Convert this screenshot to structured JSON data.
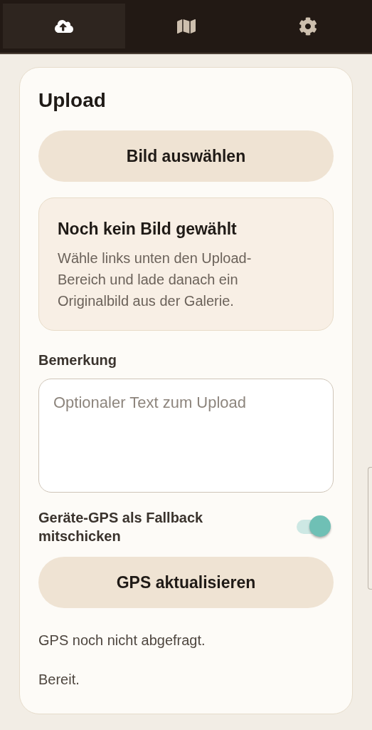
{
  "tabs": [
    {
      "kind": "upload",
      "selected": true
    },
    {
      "kind": "map",
      "selected": false
    },
    {
      "kind": "settings",
      "selected": false
    }
  ],
  "card": {
    "title": "Upload",
    "pick_button": "Bild auswählen",
    "preview": {
      "title": "Noch kein Bild gewählt",
      "text": "Wähle links unten den Upload-Bereich und lade danach ein Originalbild aus der Galerie."
    },
    "remark": {
      "label": "Bemerkung",
      "placeholder": "Optionaler Text zum Upload"
    },
    "gps_toggle": {
      "label": "Geräte-GPS als Fallback mitschicken",
      "on": true
    },
    "gps_button": "GPS aktualisieren",
    "gps_status": "GPS noch nicht abgefragt.",
    "status": "Bereit."
  }
}
